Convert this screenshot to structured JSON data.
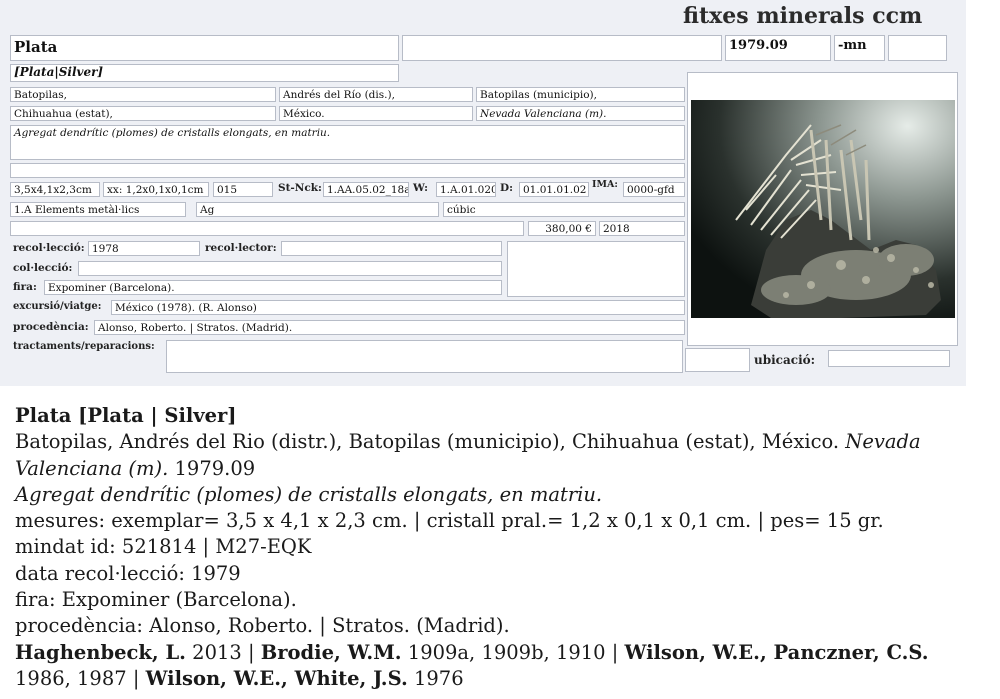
{
  "header": {
    "title": "fitxes minerals ccm"
  },
  "card": {
    "name": "Plata",
    "name_extra": "",
    "date": "1979.09",
    "code_suffix": "-mn",
    "code_box": "",
    "synonyms": "[Plata|Silver]",
    "locality": {
      "place": "Batopilas,",
      "district": "Andrés del Río (dis.),",
      "municipality": "Batopilas (municipio),",
      "state": "Chihuahua (estat),",
      "country": "México.",
      "mine": "Nevada Valenciana (m)."
    },
    "description": "Agregat dendrític (plomes) de cristalls elongats, en matriu.",
    "extra_line": "",
    "measures": {
      "size": "3,5x4,1x2,3cm",
      "crystal": "xx: 1,2x0,1x0,1cm",
      "weight": "015",
      "stnck_label": "St-Nck:",
      "stnck": "1.AA.05.02_18a",
      "w_label": "W:",
      "w": "1.A.01.020",
      "d_label": "D:",
      "d": "01.01.01.02",
      "ima_label": "IMA:",
      "ima": "0000-gfd"
    },
    "classification": {
      "group": "1.A Elements metàl·lics",
      "formula": "Ag",
      "system": "cúbic"
    },
    "price_row": {
      "note": "",
      "price": "380,00 €",
      "year": "2018"
    },
    "collection_year_label": "recol·lecció:",
    "collection_year": "1978",
    "collector_label": "recol·lector:",
    "collector": "",
    "collection_label": "col·lecció:",
    "collection": "",
    "fair_label": "fira:",
    "fair": "Expominer (Barcelona).",
    "excursion_label": "excursió/viatge:",
    "excursion": "México (1978). (R. Alonso)",
    "provenance_label": "procedència:",
    "provenance": "Alonso, Roberto. | Stratos. (Madrid).",
    "treatments_label": "tractaments/reparacions:",
    "treatments": "",
    "location_box": "",
    "location_label": "ubicació:",
    "location": ""
  },
  "summary": {
    "title_bold": "Plata [Plata | Silver]",
    "line2": "Batopilas, Andrés del Rio (distr.), Batopilas (municipio), Chihuahua (estat), México. ",
    "line2_italic": "Nevada",
    "line3_italic": "Valenciana (m).",
    "line3": " 1979.09",
    "description": "Agregat dendrític (plomes) de cristalls elongats, en matriu.",
    "measures": "mesures: exemplar= 3,5 x 4,1 x 2,3 cm. | cristall pral.= 1,2 x 0,1 x 0,1 cm. | pes= 15 gr.",
    "mindat": "mindat id: 521814 | M27-EQK",
    "collection_date": "data recol·lecció: 1979",
    "fair": "fira: Expominer (Barcelona).",
    "provenance": "procedència: Alonso, Roberto. | Stratos. (Madrid).",
    "refs": [
      {
        "author": "Haghenbeck, L.",
        "years": " 2013 | "
      },
      {
        "author": "Brodie, W.M.",
        "years": " 1909a, 1909b, 1910 | "
      },
      {
        "author": "Wilson, W.E., Panczner, C.S.",
        "years": ""
      }
    ],
    "refs_line2_years": "1986, 1987 | ",
    "refs_line2_author": "Wilson, W.E., White, J.S.",
    "refs_line2_tail": " 1976"
  }
}
